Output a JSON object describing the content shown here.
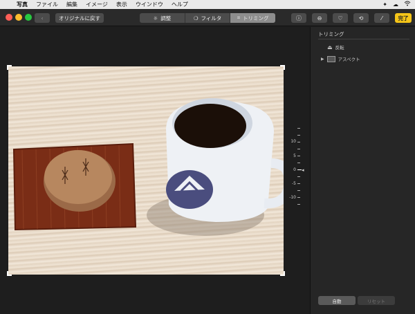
{
  "menubar": {
    "apple": "",
    "items": [
      "写真",
      "ファイル",
      "編集",
      "イメージ",
      "表示",
      "ウインドウ",
      "ヘルプ"
    ]
  },
  "toolbar": {
    "revert_label": "オリジナルに戻す",
    "tabs": [
      {
        "label": "調整",
        "icon": "adjust-icon"
      },
      {
        "label": "フィルタ",
        "icon": "filter-icon"
      },
      {
        "label": "トリミング",
        "icon": "crop-icon",
        "active": true
      }
    ],
    "done_label": "完了",
    "accent": "#f5c518"
  },
  "photo": {
    "description_icon": "photo-content"
  },
  "dial": {
    "labels": [
      "10",
      "5",
      "0",
      "-5",
      "-10"
    ]
  },
  "panel": {
    "title": "トリミング",
    "flip_label": "反転",
    "aspect_label": "アスペクト",
    "auto_label": "自動",
    "reset_label": "リセット"
  }
}
